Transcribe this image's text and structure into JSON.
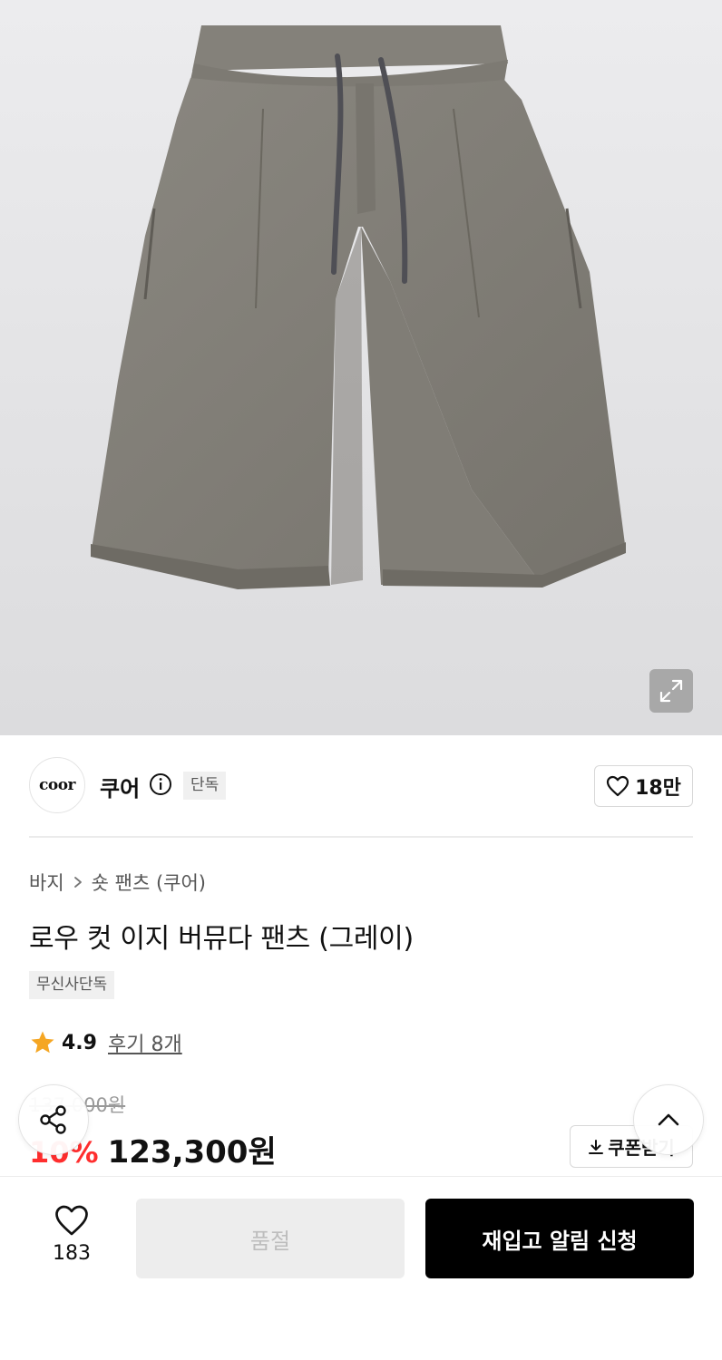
{
  "product_image": {
    "alt": "gray shorts"
  },
  "brand": {
    "logo_text": "coor",
    "name": "쿠어",
    "badge": "단독",
    "like_count": "18만"
  },
  "breadcrumb": {
    "category": "바지",
    "subcategory": "숏 팬츠 (쿠어)"
  },
  "product": {
    "title": "로우 컷 이지 버뮤다 팬츠 (그레이)",
    "exclusive_badge": "무신사단독",
    "rating": "4.9",
    "reviews_label": "후기 8개",
    "original_price": "137,000원",
    "discount": "10%",
    "price": "123,300원"
  },
  "coupon": {
    "label": "쿠폰받기"
  },
  "bottom_bar": {
    "wish_count": "183",
    "soldout_label": "품절",
    "restock_label": "재입고 알림 신청"
  },
  "colors": {
    "accent": "#ff2e2e",
    "star": "#f5a623",
    "primary_button": "#000000"
  }
}
